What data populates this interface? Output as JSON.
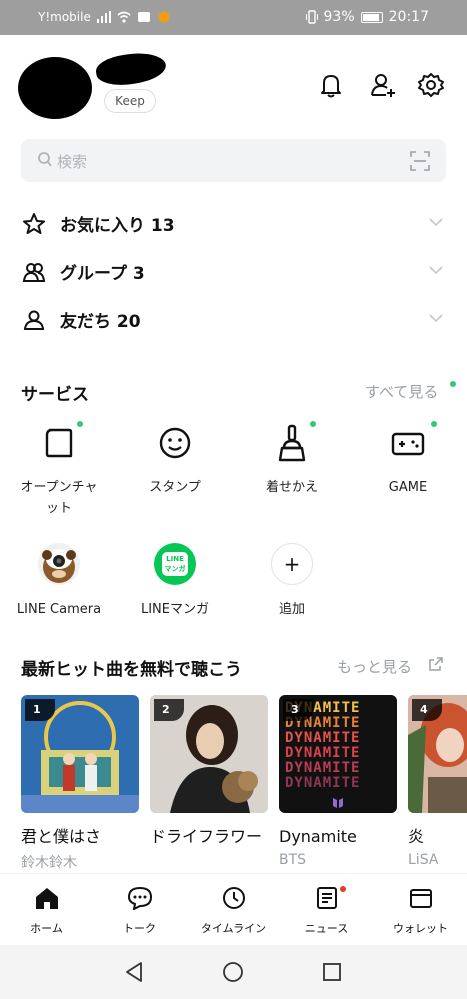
{
  "status_bar": {
    "carrier": "Y!mobile",
    "battery": "93%",
    "time": "20:17"
  },
  "profile": {
    "keep_label": "Keep"
  },
  "header_icons": [
    "bell-icon",
    "add-friend-icon",
    "gear-icon"
  ],
  "search": {
    "placeholder": "検索"
  },
  "friends": [
    {
      "label": "お気に入り 13",
      "icon": "star-icon"
    },
    {
      "label": "グループ 3",
      "icon": "group-icon"
    },
    {
      "label": "友だち 20",
      "icon": "person-icon"
    }
  ],
  "services": {
    "title": "サービス",
    "see_all": "すべて見る",
    "items": [
      {
        "label": "オープンチャット",
        "icon": "open-chat-icon"
      },
      {
        "label": "スタンプ",
        "icon": "sticker-smile-icon"
      },
      {
        "label": "着せかえ",
        "icon": "brush-theme-icon"
      },
      {
        "label": "GAME",
        "icon": "gamepad-icon"
      }
    ],
    "items2": [
      {
        "label": "LINE Camera",
        "icon": "line-camera-icon"
      },
      {
        "label": "LINEマンガ",
        "icon": "line-manga-icon"
      },
      {
        "label": "追加",
        "icon": "plus-icon"
      }
    ],
    "manga_logo_line1": "LINE",
    "manga_logo_line2": "マンガ",
    "plus_symbol": "+"
  },
  "music": {
    "title": "最新ヒット曲を無料で聴こう",
    "more": "もっと見る",
    "cards": [
      {
        "rank": "1",
        "title": "君と僕はさ",
        "artist": "鈴木鈴木",
        "color": "#2f6db1"
      },
      {
        "rank": "2",
        "title": "ドライフラワー",
        "artist": "",
        "color": "#b9b1a6"
      },
      {
        "rank": "3",
        "title": "Dynamite",
        "artist": "BTS",
        "color": "#111111"
      },
      {
        "rank": "4",
        "title": "炎",
        "artist": "LiSA",
        "color": "#c46a5a"
      }
    ],
    "dynamite_text": "DYNAMITE"
  },
  "bottom_nav": [
    {
      "label": "ホーム",
      "icon": "home-icon"
    },
    {
      "label": "トーク",
      "icon": "chat-bubble-icon"
    },
    {
      "label": "タイムライン",
      "icon": "clock-icon"
    },
    {
      "label": "ニュース",
      "icon": "news-icon"
    },
    {
      "label": "ウォレット",
      "icon": "wallet-icon"
    }
  ],
  "colors": {
    "accent_green": "#2ecc71",
    "notification_red": "#e53935",
    "status_bar": "#9e9e9e"
  }
}
